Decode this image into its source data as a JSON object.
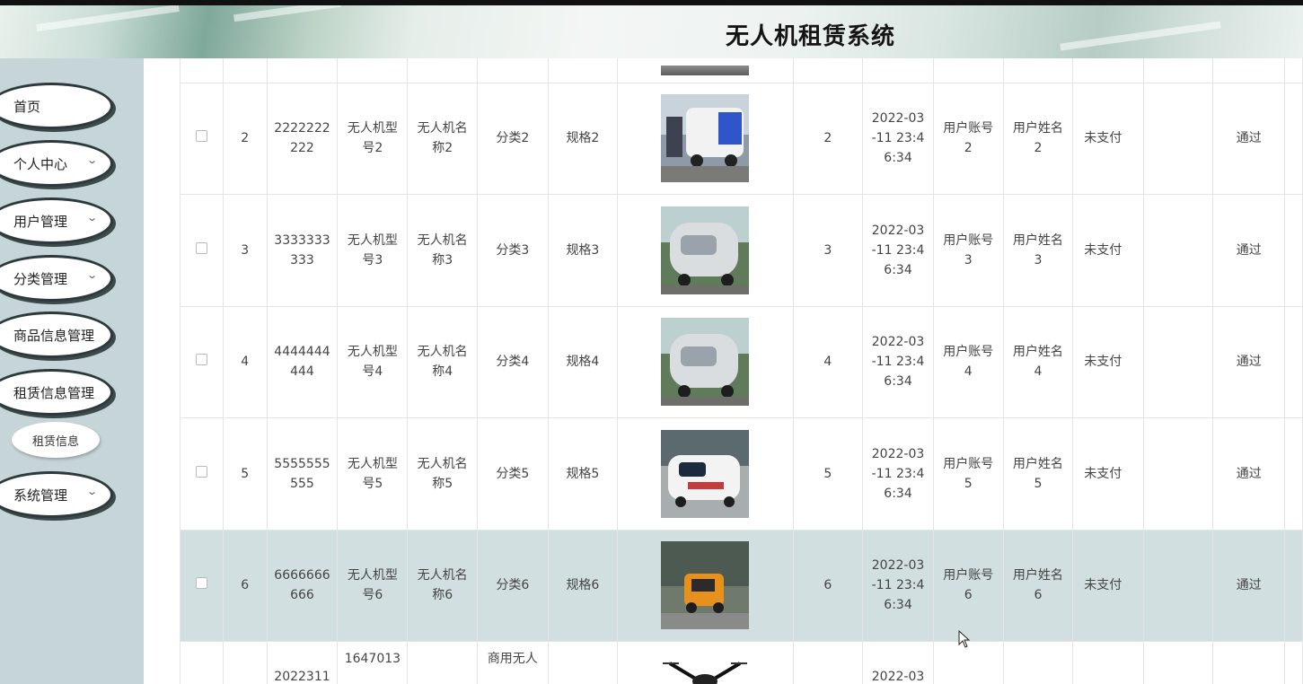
{
  "app": {
    "title": "无人机租赁系统"
  },
  "sidebar": {
    "items": [
      {
        "label": "首页",
        "has_chevron": false
      },
      {
        "label": "个人中心",
        "has_chevron": true
      },
      {
        "label": "用户管理",
        "has_chevron": true
      },
      {
        "label": "分类管理",
        "has_chevron": true
      },
      {
        "label": "商品信息管理",
        "has_chevron": false
      },
      {
        "label": "租赁信息管理",
        "has_chevron": false
      },
      {
        "label": "系统管理",
        "has_chevron": true
      }
    ],
    "subitem": {
      "label": "租赁信息"
    }
  },
  "table": {
    "rows": [
      {
        "index": "2",
        "order_no": "2222222222",
        "model": "无人机型号2",
        "name": "无人机名称2",
        "category": "分类2",
        "spec": "规格2",
        "image_icon": "delivery-robot-image",
        "qty": "2",
        "time": "2022-03-11 23:46:34",
        "account": "用户账号2",
        "user_name": "用户姓名2",
        "pay_status": "未支付",
        "review": "通过"
      },
      {
        "index": "3",
        "order_no": "3333333333",
        "model": "无人机型号3",
        "name": "无人机名称3",
        "category": "分类3",
        "spec": "规格3",
        "image_icon": "delivery-robot-image",
        "qty": "3",
        "time": "2022-03-11 23:46:34",
        "account": "用户账号3",
        "user_name": "用户姓名3",
        "pay_status": "未支付",
        "review": "通过"
      },
      {
        "index": "4",
        "order_no": "4444444444",
        "model": "无人机型号4",
        "name": "无人机名称4",
        "category": "分类4",
        "spec": "规格4",
        "image_icon": "delivery-robot-image",
        "qty": "4",
        "time": "2022-03-11 23:46:34",
        "account": "用户账号4",
        "user_name": "用户姓名4",
        "pay_status": "未支付",
        "review": "通过"
      },
      {
        "index": "5",
        "order_no": "5555555555",
        "model": "无人机型号5",
        "name": "无人机名称5",
        "category": "分类5",
        "spec": "规格5",
        "image_icon": "delivery-robot-image",
        "qty": "5",
        "time": "2022-03-11 23:46:34",
        "account": "用户账号5",
        "user_name": "用户姓名5",
        "pay_status": "未支付",
        "review": "通过"
      },
      {
        "index": "6",
        "order_no": "6666666666",
        "model": "无人机型号6",
        "name": "无人机名称6",
        "category": "分类6",
        "spec": "规格6",
        "image_icon": "delivery-vehicle-image",
        "qty": "6",
        "time": "2022-03-11 23:46:34",
        "account": "用户账号6",
        "user_name": "用户姓名6",
        "pay_status": "未支付",
        "review": "通过"
      }
    ],
    "partial_bottom": {
      "order_no": "2022311",
      "order_no_2": "1647013",
      "category": "商用无人",
      "time": "2022-03"
    }
  },
  "colors": {
    "sidebar_bg": "#c6d5d8",
    "highlight_row": "#d1dfe0",
    "menu_border": "#2c3a3c"
  }
}
